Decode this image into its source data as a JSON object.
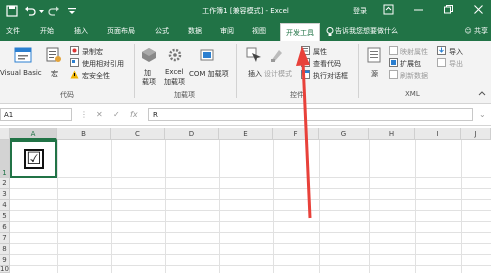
{
  "titlebar": {
    "title": "工作簿1 [兼容模式] - Excel",
    "signin": "登录",
    "icons": [
      "save-icon",
      "undo-icon",
      "redo-icon",
      "customize-icon"
    ],
    "window_controls": [
      "ribbon-display-icon",
      "minimize-icon",
      "restore-icon",
      "close-icon"
    ]
  },
  "menubar": {
    "tabs": [
      "文件",
      "开始",
      "插入",
      "页面布局",
      "公式",
      "数据",
      "审阅",
      "视图",
      "开发工具"
    ],
    "active_tab": "开发工具",
    "tell_me": "告诉我您想要做什么",
    "share": "共享"
  },
  "ribbon": {
    "code": {
      "visual_basic": "Visual Basic",
      "macros": "宏",
      "record_macro": "录制宏",
      "relative_refs": "使用相对引用",
      "macro_security": "宏安全性",
      "label": "代码"
    },
    "addins": {
      "addins_top": "加",
      "addins_bottom": "载项",
      "excel_addins_top": "Excel",
      "excel_addins_bottom": "加载项",
      "com_addins": "COM 加载项",
      "label": "加载项"
    },
    "controls": {
      "insert": "插入",
      "design_mode": "设计模式",
      "properties": "属性",
      "view_code": "查看代码",
      "run_dialog": "执行对话框",
      "label": "控件"
    },
    "xml": {
      "source": "源",
      "map_properties": "映射属性",
      "expansion_packs": "扩展包",
      "refresh_data": "刷新数据",
      "import": "导入",
      "export": "导出",
      "label": "XML"
    }
  },
  "formula_bar": {
    "name_box": "A1",
    "cancel": "✕",
    "enter": "✓",
    "fx": "fx",
    "value": "R"
  },
  "grid": {
    "columns": [
      "A",
      "B",
      "C",
      "D",
      "E",
      "F",
      "G",
      "H",
      "I",
      "J"
    ],
    "rows": [
      "1",
      "2",
      "3",
      "4",
      "5",
      "6",
      "7",
      "8",
      "9",
      "10"
    ],
    "cell_A1": "☑"
  },
  "colors": {
    "accent": "#217346",
    "arrow": "#e8413a"
  }
}
